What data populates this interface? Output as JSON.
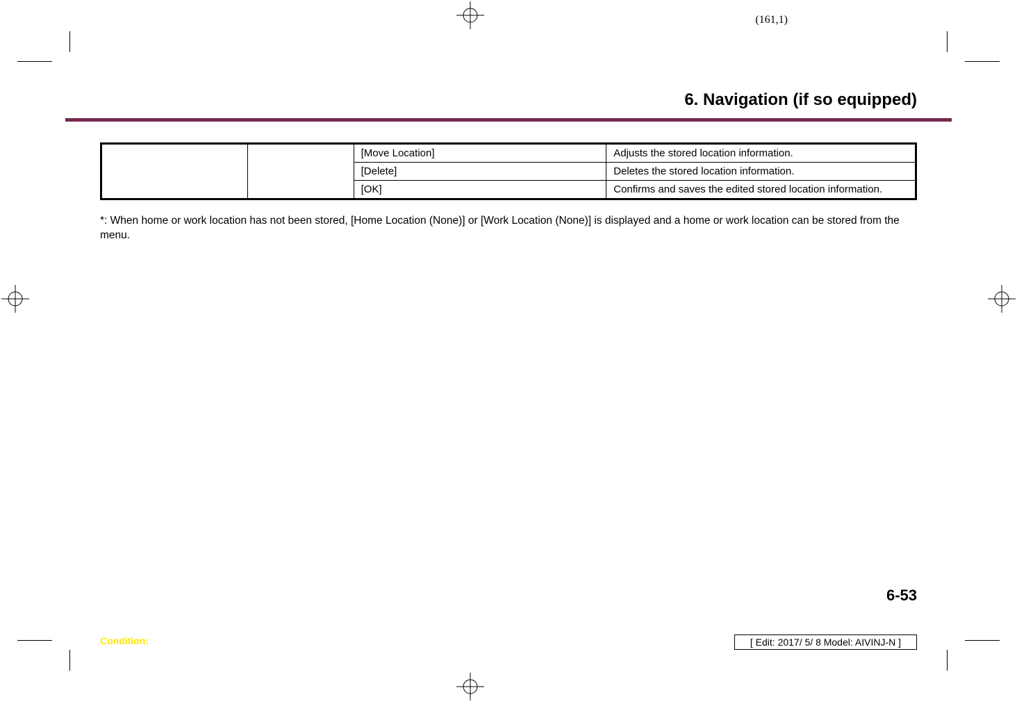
{
  "page_coord": "(161,1)",
  "section_title": "6. Navigation (if so equipped)",
  "table": {
    "rows": [
      {
        "c": "[Move Location]",
        "d": "Adjusts the stored location information."
      },
      {
        "c": "[Delete]",
        "d": "Deletes the stored location information."
      },
      {
        "c": "[OK]",
        "d": "Confirms and saves the edited stored location information."
      }
    ]
  },
  "footnote": "*: When home or work location has not been stored, [Home Location (None)] or [Work Location (None)] is displayed and a home or work location can be stored from the menu.",
  "page_num": "6-53",
  "condition_label": "Condition:",
  "edit_box": "[ Edit: 2017/ 5/ 8   Model: AIVINJ-N ]"
}
